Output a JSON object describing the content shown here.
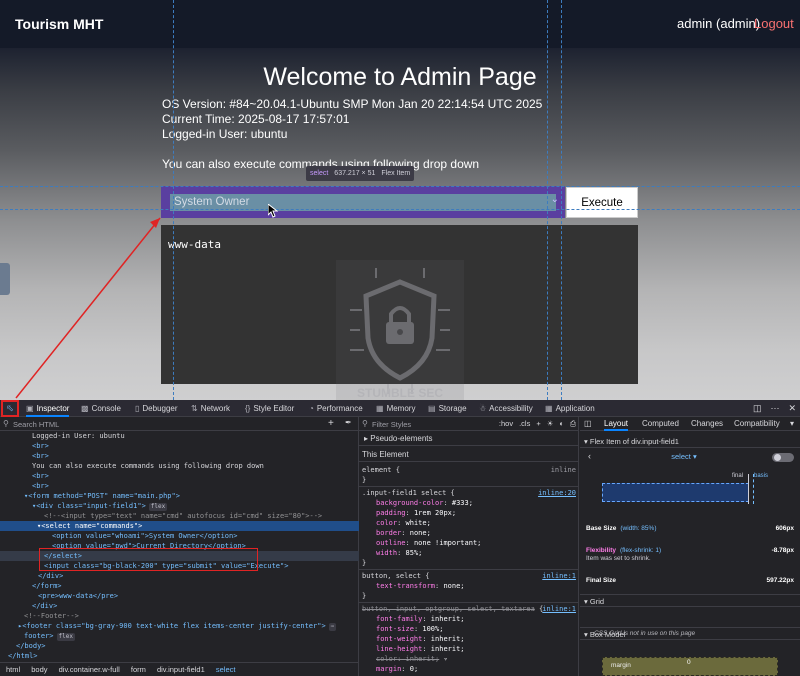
{
  "page": {
    "brand": "Tourism MHT",
    "user": "admin (admin)",
    "logout": "Logout",
    "title": "Welcome to Admin Page",
    "os_line": "OS Version: #84~20.04.1-Ubuntu SMP Mon Jan 20 22:14:54 UTC 2025",
    "time_line": "Current Time: 2025-08-17 17:57:01",
    "user_line": "Logged-in User: ubuntu",
    "cmd_hint": "You can also execute commands using following drop down",
    "select_value": "System Owner",
    "execute_label": "Execute",
    "output": "www-data",
    "watermark_text": "STUMBLE SEC",
    "tooltip": {
      "tag": "select",
      "size": "637.217 × 51",
      "kind": "Flex Item"
    }
  },
  "devtools": {
    "tabs": [
      {
        "label": "Inspector",
        "icon": "inspector-icon"
      },
      {
        "label": "Console",
        "icon": "console-icon"
      },
      {
        "label": "Debugger",
        "icon": "debugger-icon"
      },
      {
        "label": "Network",
        "icon": "network-icon"
      },
      {
        "label": "Style Editor",
        "icon": "style-editor-icon"
      },
      {
        "label": "Performance",
        "icon": "performance-icon"
      },
      {
        "label": "Memory",
        "icon": "memory-icon"
      },
      {
        "label": "Storage",
        "icon": "storage-icon"
      },
      {
        "label": "Accessibility",
        "icon": "accessibility-icon"
      },
      {
        "label": "Application",
        "icon": "application-icon"
      }
    ],
    "markup_search_placeholder": "Search HTML",
    "markup": [
      "Logged-in User: ubuntu",
      "<br>",
      "<br>",
      "You can also execute commands using following drop down",
      "<br>",
      "<br>",
      "<form method=\"POST\" name=\"main.php\">",
      "<div class=\"input-field1\">",
      "<!--<input type=\"text\" name=\"cmd\" autofocus id=\"cmd\" size=\"80\">-->",
      "<select name=\"commands\">",
      "<option value=\"whoami\">System Owner</option>",
      "<option value=\"pwd\">Current Directory</option>",
      "</select>",
      "<input class=\"bg-black-200\" type=\"submit\" value=\"Execute\">",
      "</div>",
      "</form>",
      "<pre>www-data</pre>",
      "</div>",
      "<!--Footer-->",
      "<footer class=\"bg-gray-900 text-white flex items-center justify-center\">",
      "footer>",
      "</body>",
      "</html>"
    ],
    "badges": {
      "flex": "flex",
      "event": "event"
    },
    "breadcrumb": [
      "html",
      "body",
      "div.container.w-full",
      "form",
      "div.input-field1",
      "select"
    ],
    "rules": {
      "filter_placeholder": "Filter Styles",
      "hov": ":hov",
      "cls": ".cls",
      "pseudo": "Pseudo-elements",
      "this_element": "This Element",
      "element_selector": "element {",
      "element_src": "inline",
      "r1_selector": ".input-field1 select",
      "r1_src": "inline:20",
      "r1_props": [
        [
          "background-color",
          "#333;"
        ],
        [
          "padding",
          "1rem 20px;"
        ],
        [
          "color",
          "white;"
        ],
        [
          "border",
          "none;"
        ],
        [
          "outline",
          "none !important;"
        ],
        [
          "width",
          "85%;"
        ]
      ],
      "r2_selector": "button, select",
      "r2_src": "inline:1",
      "r2_props": [
        [
          "text-transform",
          "none;"
        ]
      ],
      "r3_selector": "button, input, optgroup, select, textarea",
      "r3_src": "inline:1",
      "r3_props": [
        [
          "font-family",
          "inherit;"
        ],
        [
          "font-size",
          "100%;"
        ],
        [
          "font-weight",
          "inherit;"
        ],
        [
          "line-height",
          "inherit;"
        ],
        [
          "color",
          "inherit;"
        ],
        [
          "margin",
          "0;"
        ]
      ]
    },
    "layout": {
      "tabs": [
        "Layout",
        "Computed",
        "Changes",
        "Compatibility"
      ],
      "flex_item_header": "Flex Item of div.input-field1",
      "flex_selector": "select",
      "final_label": "final",
      "basis_label": "basis",
      "base_size_label": "Base Size",
      "base_size_desc": "(width: 85%)",
      "base_size_value": "606px",
      "flexibility_label": "Flexibility",
      "flexibility_desc": "(flex-shrink: 1)",
      "flexibility_sub": "Item was set to shrink.",
      "flexibility_value": "-8.78px",
      "final_size_label": "Final Size",
      "final_size_value": "597.22px",
      "grid_header": "Grid",
      "grid_note": "CSS Grid is not in use on this page",
      "box_header": "Box Model",
      "margin_label": "margin",
      "margin_value": "0"
    }
  },
  "colors": {
    "accent": "#0a84ff",
    "highlight": "#e02424",
    "select_bg": "#5a3fa0",
    "logout": "#f87171"
  }
}
